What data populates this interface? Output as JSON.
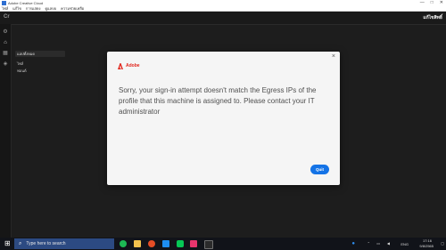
{
  "window": {
    "title": "Adobe Creative Cloud",
    "controls": [
      "—",
      "□",
      "✕"
    ]
  },
  "menu": [
    "ไฟล์",
    "แก้ไข",
    "การแสดง",
    "ดูแลบบ",
    "ความช่วยเหลือ"
  ],
  "app": {
    "logo": "Cr",
    "user": "แก้ไขสิทธิ์"
  },
  "sidebar": [
    {
      "label": "แอปทั้งหมด"
    },
    {
      "label": "ไฟล์"
    },
    {
      "label": "ฟอนต์"
    }
  ],
  "dialog": {
    "brand": "Adobe",
    "message": "Sorry, your sign-in attempt doesn't match the Egress IPs of the profile that this machine is assigned to. Please contact your IT administrator",
    "button": "Quit",
    "close": "×"
  },
  "taskbar": {
    "search_placeholder": "Type here to search",
    "lang": "ENG",
    "time": "17:16",
    "date": "9/8/2565"
  },
  "colors": {
    "accent": "#1473e6",
    "brand": "#e1251b"
  }
}
